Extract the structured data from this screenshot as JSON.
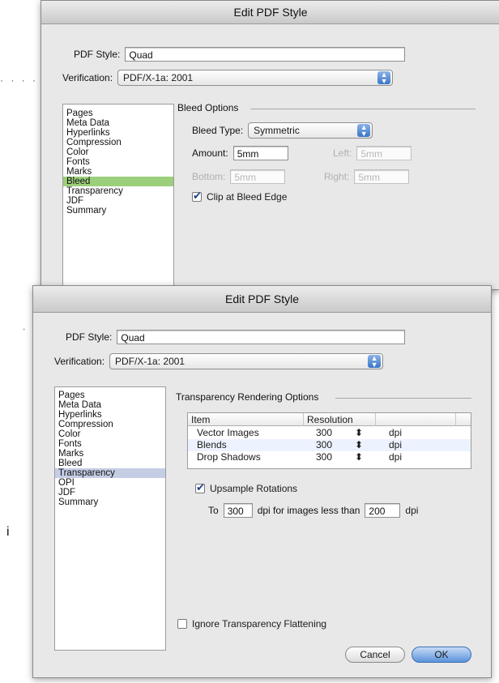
{
  "page": {
    "dots_left": "· · · ·",
    "dot_middle": ".",
    "stray_char": "i"
  },
  "window1": {
    "title": "Edit PDF Style",
    "pdf_style_label": "PDF Style:",
    "pdf_style_value": "Quad",
    "verification_label": "Verification:",
    "verification_value": "PDF/X-1a: 2001",
    "sidebar": [
      "Pages",
      "Meta Data",
      "Hyperlinks",
      "Compression",
      "Color",
      "Fonts",
      "Marks",
      "Bleed",
      "Transparency",
      "JDF",
      "Summary"
    ],
    "sidebar_selected": "Bleed",
    "group_title": "Bleed Options",
    "bleed_type_label": "Bleed Type:",
    "bleed_type_value": "Symmetric",
    "amount_label": "Amount:",
    "amount_value": "5mm",
    "left_label": "Left:",
    "left_value": "5mm",
    "bottom_label": "Bottom:",
    "bottom_value": "5mm",
    "right_label": "Right:",
    "right_value": "5mm",
    "clip_label": "Clip at Bleed Edge",
    "clip_checked": true
  },
  "window2": {
    "title": "Edit PDF Style",
    "pdf_style_label": "PDF Style:",
    "pdf_style_value": "Quad",
    "verification_label": "Verification:",
    "verification_value": "PDF/X-1a: 2001",
    "sidebar": [
      "Pages",
      "Meta Data",
      "Hyperlinks",
      "Compression",
      "Color",
      "Fonts",
      "Marks",
      "Bleed",
      "Transparency",
      "OPI",
      "JDF",
      "Summary"
    ],
    "sidebar_selected": "Transparency",
    "group_title": "Transparency Rendering Options",
    "table": {
      "headers": [
        "Item",
        "Resolution"
      ],
      "rows": [
        {
          "item": "Vector Images",
          "resolution": "300",
          "unit": "dpi"
        },
        {
          "item": "Blends",
          "resolution": "300",
          "unit": "dpi"
        },
        {
          "item": "Drop Shadows",
          "resolution": "300",
          "unit": "dpi"
        }
      ]
    },
    "upsample_label": "Upsample Rotations",
    "upsample_checked": true,
    "to_label": "To",
    "to_value": "300",
    "dpi_for_label": "dpi for images less than",
    "less_than_value": "200",
    "dpi_label": "dpi",
    "ignore_label": "Ignore Transparency Flattening",
    "ignore_checked": false,
    "cancel_label": "Cancel",
    "ok_label": "OK"
  }
}
